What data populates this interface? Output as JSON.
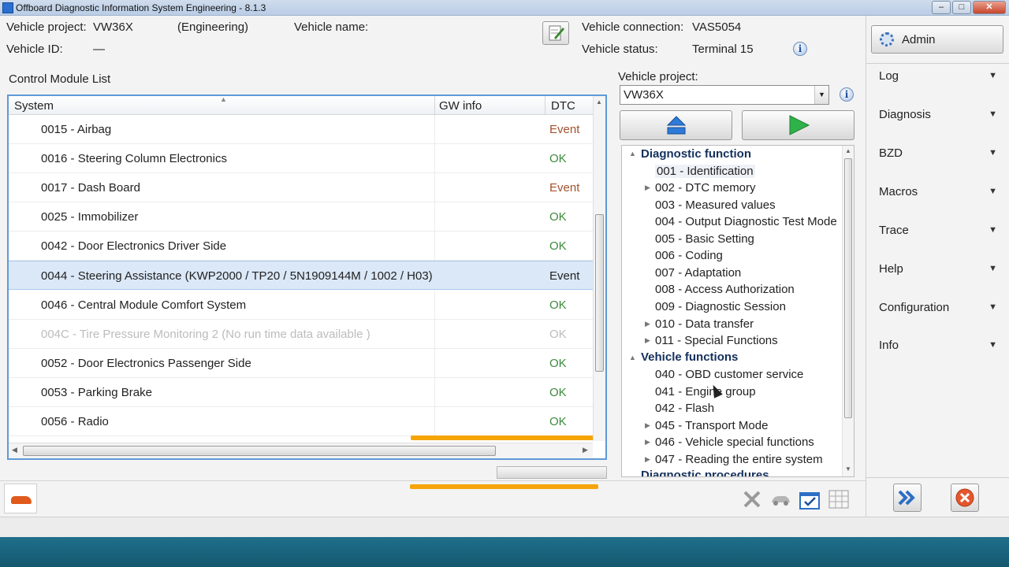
{
  "window": {
    "title": "Offboard Diagnostic Information System Engineering - 8.1.3"
  },
  "vehicle": {
    "project_label": "Vehicle project:",
    "project_value": "VW36X",
    "mode": "(Engineering)",
    "name_label": "Vehicle name:",
    "id_label": "Vehicle ID:",
    "id_value": "—",
    "connection_label": "Vehicle connection:",
    "connection_value": "VAS5054",
    "status_label": "Vehicle status:",
    "status_value": "Terminal 15"
  },
  "left_panel": {
    "title": "Control Module List",
    "columns": {
      "system": "System",
      "gw_info": "GW info",
      "dtc": "DTC"
    },
    "rows": [
      {
        "name": "0015 - Airbag",
        "dtc": "Event"
      },
      {
        "name": "0016 - Steering Column Electronics",
        "dtc": "OK"
      },
      {
        "name": "0017 - Dash Board",
        "dtc": "Event"
      },
      {
        "name": "0025 - Immobilizer",
        "dtc": "OK"
      },
      {
        "name": "0042 - Door Electronics Driver Side",
        "dtc": "OK"
      },
      {
        "name": "0044 - Steering Assistance  (KWP2000 / TP20 / 5N1909144M / 1002 / H03)",
        "dtc": "Event"
      },
      {
        "name": "0046 - Central Module Comfort System",
        "dtc": "OK"
      },
      {
        "name": "004C - Tire Pressure Monitoring 2  (No run time data available )",
        "dtc": "OK"
      },
      {
        "name": "0052 - Door Electronics Passenger Side",
        "dtc": "OK"
      },
      {
        "name": "0053 - Parking Brake",
        "dtc": "OK"
      },
      {
        "name": "0056 - Radio",
        "dtc": "OK"
      }
    ]
  },
  "mid_panel": {
    "project_label": "Vehicle project:",
    "project_select": "VW36X",
    "tree": {
      "group1": "Diagnostic function",
      "g1_items": [
        "001 - Identification",
        "002 - DTC memory",
        "003 - Measured values",
        "004 - Output Diagnostic Test Mode",
        "005 - Basic Setting",
        "006 - Coding",
        "007 - Adaptation",
        "008 - Access Authorization",
        "009 - Diagnostic Session",
        "010 - Data transfer",
        "011 - Special Functions"
      ],
      "group2": "Vehicle functions",
      "g2_items": [
        "040 - OBD customer service",
        "041 - Engine group",
        "042 - Flash",
        "045 - Transport Mode",
        "046 - Vehicle special functions",
        "047 - Reading the entire system"
      ],
      "group3": "Diagnostic procedures"
    }
  },
  "sidebar": {
    "admin": "Admin",
    "items": [
      "Log",
      "Diagnosis",
      "BZD",
      "Macros",
      "Trace",
      "Help",
      "Configuration",
      "Info"
    ]
  },
  "colors": {
    "event": "#a0522d",
    "ok": "#3c8a3c",
    "selection": "#dbe8f7",
    "accent_border": "#5e9ad8",
    "progress": "#f5a40a"
  },
  "icons": {
    "edit": "edit-icon",
    "info": "info-icon",
    "admin": "gear-icon",
    "home": "eject-icon",
    "play": "play-icon",
    "forward": "double-chevron-right-icon",
    "cancel": "close-circle-icon"
  }
}
